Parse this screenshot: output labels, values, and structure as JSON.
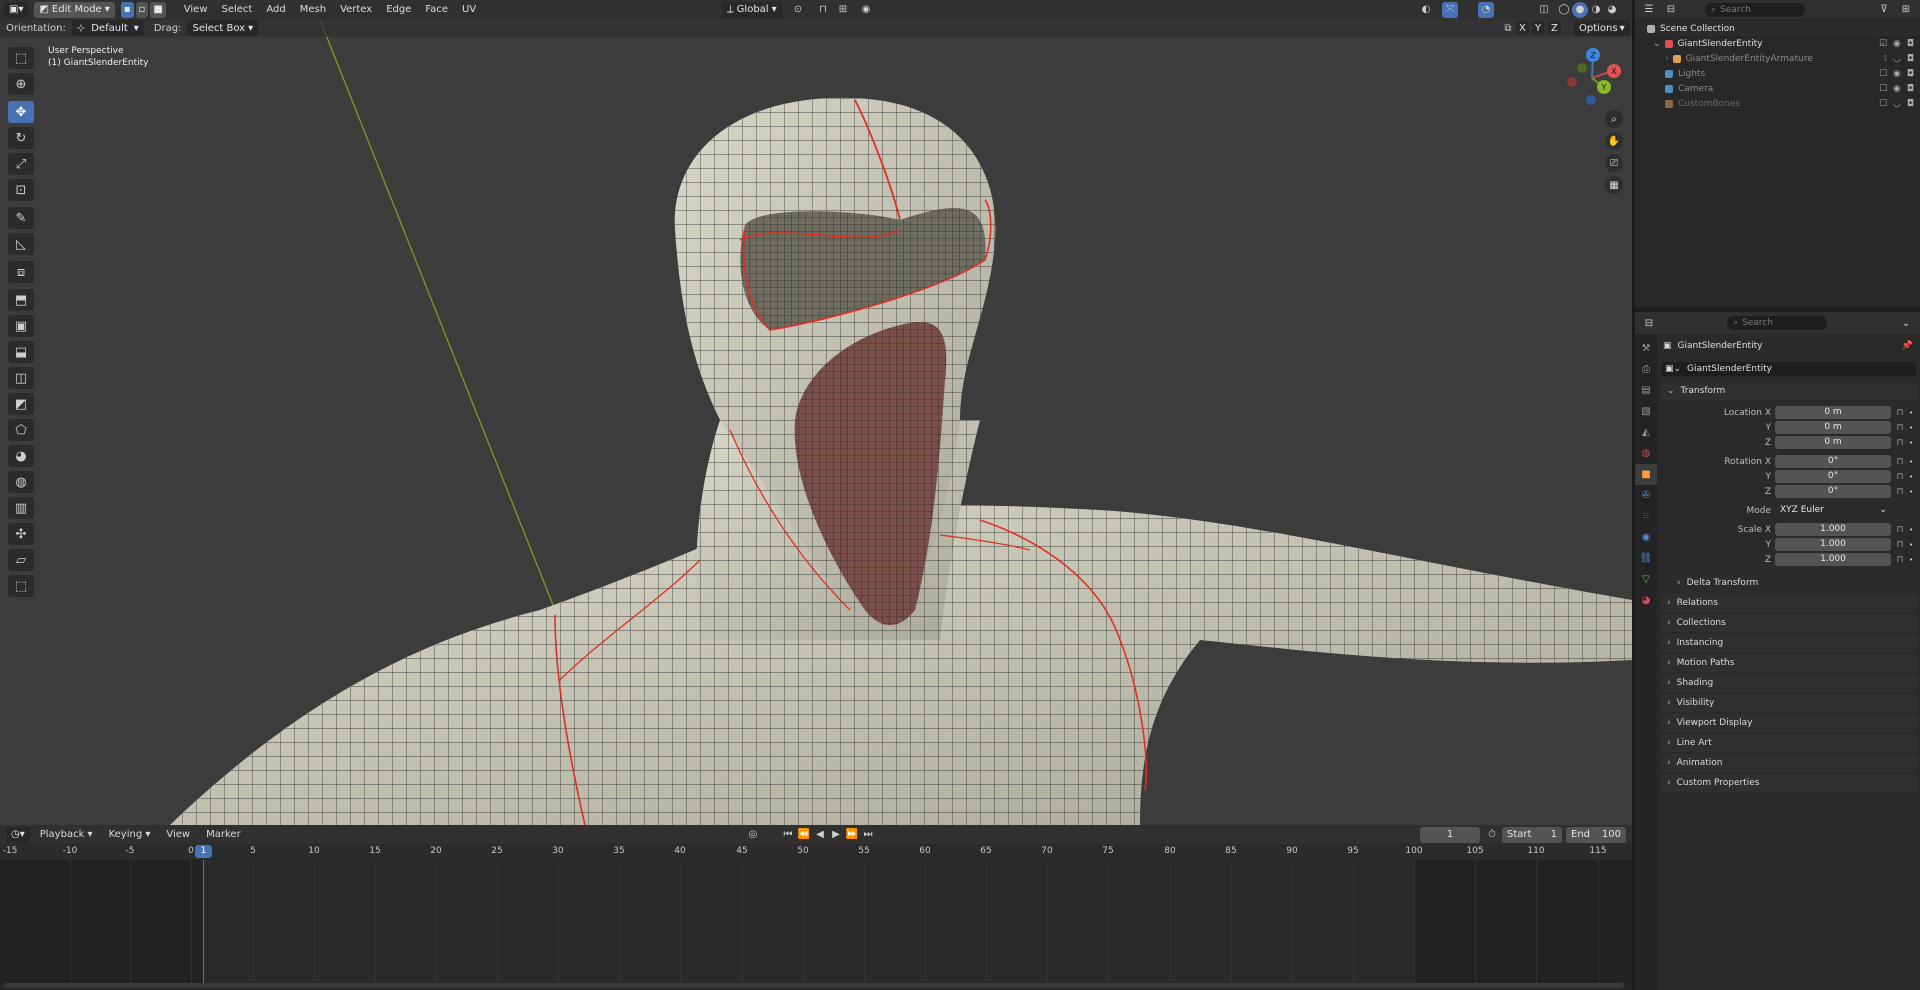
{
  "viewport_header": {
    "editor_icon": "cube-icon",
    "mode": "Edit Mode",
    "menus": [
      "View",
      "Select",
      "Add",
      "Mesh",
      "Vertex",
      "Edge",
      "Face",
      "UV"
    ],
    "transform_orientation": "Global",
    "options_label": "Options",
    "axis_labels": [
      "X",
      "Y",
      "Z"
    ]
  },
  "tool_header": {
    "orientation_label": "Orientation:",
    "orientation_value": "Default",
    "drag_label": "Drag:",
    "drag_value": "Select Box"
  },
  "viewport": {
    "view_name": "User Perspective",
    "object_label": "(1) GiantSlenderEntity",
    "gizmo": {
      "x": "X",
      "y": "Y",
      "z": "Z"
    }
  },
  "toolbar": {
    "tools": [
      "select-box",
      "cursor",
      "move",
      "rotate",
      "scale",
      "transform",
      "annotate",
      "measure",
      "add-cube",
      "extrude",
      "inset",
      "bevel",
      "loop-cut",
      "knife",
      "poly-build",
      "spin",
      "smooth",
      "edge-slide",
      "shrink-fatten",
      "shear",
      "rip"
    ]
  },
  "outliner": {
    "search_placeholder": "Search",
    "items": [
      {
        "label": "Scene Collection",
        "indent": 0,
        "color": "#b0b0b0",
        "icon": "scene-collection-icon"
      },
      {
        "label": "GiantSlenderEntity",
        "indent": 1,
        "color": "#e05050",
        "icon": "collection-icon"
      },
      {
        "label": "GiantSlenderEntityArmature",
        "indent": 2,
        "color": "#e0a050",
        "icon": "armature-icon"
      },
      {
        "label": "Lights",
        "indent": 1,
        "color": "#4a90c8",
        "icon": "collection-icon"
      },
      {
        "label": "Camera",
        "indent": 1,
        "color": "#4a90c8",
        "icon": "collection-icon"
      },
      {
        "label": "CustomBones",
        "indent": 1,
        "color": "#8a6a4a",
        "icon": "collection-icon"
      }
    ]
  },
  "properties": {
    "search_placeholder": "Search",
    "object_name": "GiantSlenderEntity",
    "data_name": "GiantSlenderEntity",
    "transform_title": "Transform",
    "location_label": "Location X",
    "rotation_label": "Rotation X",
    "scale_label": "Scale X",
    "axis_y": "Y",
    "axis_z": "Z",
    "location": [
      "0 m",
      "0 m",
      "0 m"
    ],
    "rotation": [
      "0°",
      "0°",
      "0°"
    ],
    "mode_label": "Mode",
    "mode_value": "XYZ Euler",
    "scale": [
      "1.000",
      "1.000",
      "1.000"
    ],
    "delta_transform": "Delta Transform",
    "sections": [
      "Relations",
      "Collections",
      "Instancing",
      "Motion Paths",
      "Shading",
      "Visibility",
      "Viewport Display",
      "Line Art",
      "Animation",
      "Custom Properties"
    ]
  },
  "timeline": {
    "menus": [
      "Playback",
      "Keying",
      "View",
      "Marker"
    ],
    "current_frame": "1",
    "start_label": "Start",
    "start_value": "1",
    "end_label": "End",
    "end_value": "100",
    "ticks": [
      "-15",
      "-10",
      "-5",
      "0",
      "5",
      "10",
      "15",
      "20",
      "25",
      "30",
      "35",
      "40",
      "45",
      "50",
      "55",
      "60",
      "65",
      "70",
      "75",
      "80",
      "85",
      "90",
      "95",
      "100",
      "105",
      "110",
      "115"
    ]
  }
}
